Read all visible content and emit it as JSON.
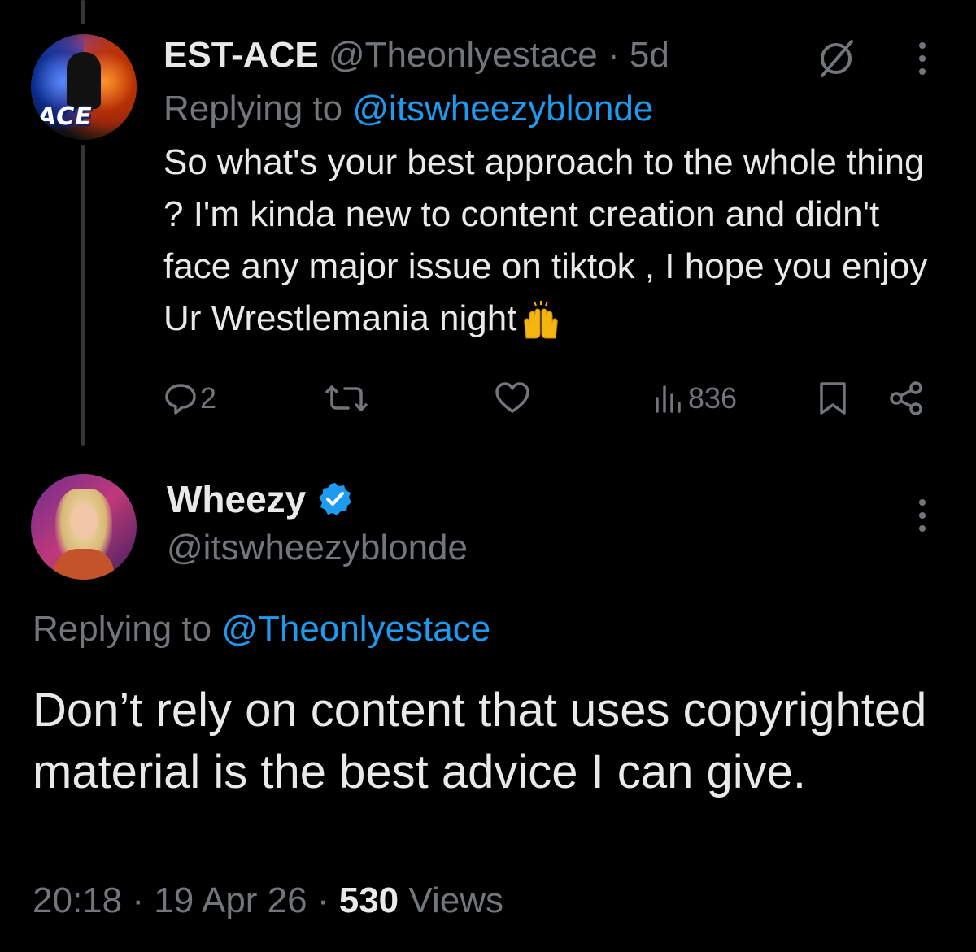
{
  "tweet1": {
    "display_name": "EST-ACE",
    "handle": "@Theonlyestace",
    "separator": "·",
    "time": "5d",
    "replying_prefix": "Replying to",
    "replying_to": "@itswheezyblonde",
    "body": "So what's your best approach to the whole thing ? I'm kinda new to content creation and didn't face any major issue on tiktok , I hope you enjoy Ur Wrestlemania night",
    "avatar_badge": "ACE",
    "emoji": "raising-hands-emoji",
    "actions": {
      "reply_count": "2",
      "views_count": "836"
    }
  },
  "tweet2": {
    "display_name": "Wheezy",
    "handle": "@itswheezyblonde",
    "replying_prefix": "Replying to",
    "replying_to": "@Theonlyestace",
    "body": "Don’t rely on content that uses copyrighted material is the best advice I can give.",
    "time": "20:18",
    "date": "19 Apr 26",
    "separator": "·",
    "views_count": "530",
    "views_label": "Views"
  },
  "icons": {
    "grok": "grok-icon",
    "more": "more-vertical-icon",
    "reply": "reply-icon",
    "retweet": "retweet-icon",
    "like": "heart-icon",
    "views": "views-chart-icon",
    "bookmark": "bookmark-icon",
    "share": "share-icon",
    "verified": "verified-badge-icon"
  },
  "colors": {
    "background": "#000000",
    "text": "#e7e9ea",
    "muted": "#71767b",
    "link": "#1d9bf0",
    "thread_line": "#333639"
  }
}
